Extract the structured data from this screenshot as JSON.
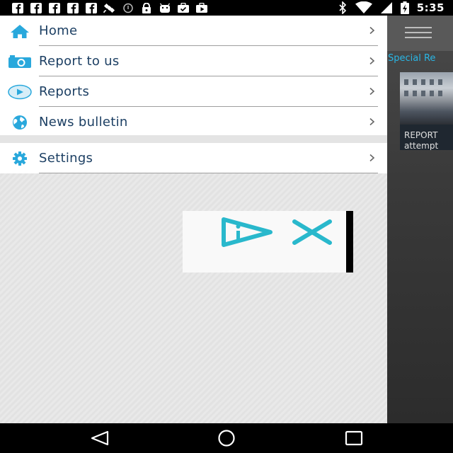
{
  "status_bar": {
    "time": "5:35",
    "left_icons": [
      "facebook-icon",
      "facebook-icon",
      "facebook-icon",
      "facebook-icon",
      "facebook-icon",
      "satellite-icon",
      "alarm-icon",
      "lock-icon",
      "android-icon",
      "briefcase-check-icon",
      "briefcase-play-icon"
    ],
    "right_icons": [
      "bluetooth-icon",
      "wifi-icon",
      "signal-icon",
      "battery-charging-icon"
    ]
  },
  "drawer": {
    "items": [
      {
        "label": "Home",
        "icon": "home-icon"
      },
      {
        "label": "Report to us",
        "icon": "camera-icon"
      },
      {
        "label": "Reports",
        "icon": "play-circle-icon"
      },
      {
        "label": "News bulletin",
        "icon": "globe-icon"
      },
      {
        "label": "Settings",
        "icon": "gear-icon"
      }
    ],
    "accent": "#29a8dc",
    "label_color": "#1c3f63"
  },
  "background_app": {
    "section_label": "Special Re",
    "article_line1": "REPORT",
    "article_line2": "attempt"
  },
  "ad": {
    "icons": [
      "ad-info-play-icon",
      "ad-close-icon"
    ]
  },
  "nav_bar": {
    "buttons": [
      "back-icon",
      "home-circle-icon",
      "recents-icon"
    ]
  }
}
